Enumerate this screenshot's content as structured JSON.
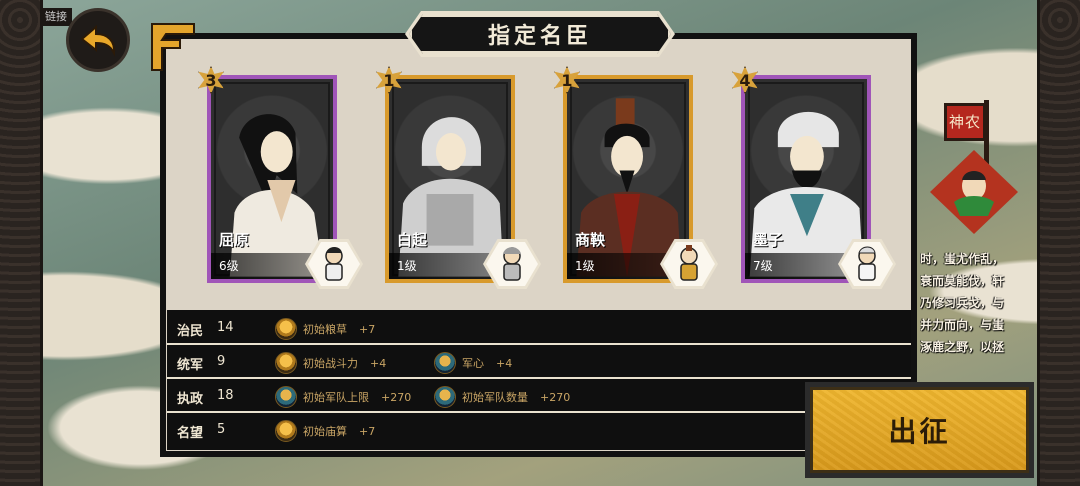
{
  "title": "指定名臣",
  "top_left_tag": "链接",
  "cards": [
    {
      "name": "屈原",
      "level": "6级",
      "rank": "3",
      "frame": "purple"
    },
    {
      "name": "白起",
      "level": "1级",
      "rank": "1",
      "frame": "gold"
    },
    {
      "name": "商鞅",
      "level": "1级",
      "rank": "1",
      "frame": "gold"
    },
    {
      "name": "墨子",
      "level": "7级",
      "rank": "4",
      "frame": "purple"
    }
  ],
  "stats": [
    {
      "key": "治民",
      "value": "14",
      "bonuses": [
        {
          "label": "初始粮草",
          "value": "+7",
          "icon": "grain-icon"
        }
      ]
    },
    {
      "key": "统军",
      "value": "9",
      "bonuses": [
        {
          "label": "初始战斗力",
          "value": "+4",
          "icon": "fist-icon"
        },
        {
          "label": "军心",
          "value": "+4",
          "icon": "morale-icon"
        }
      ]
    },
    {
      "key": "执政",
      "value": "18",
      "bonuses": [
        {
          "label": "初始军队上限",
          "value": "+270",
          "icon": "troops-icon"
        },
        {
          "label": "初始军队数量",
          "value": "+270",
          "icon": "troops-icon"
        }
      ]
    },
    {
      "key": "名望",
      "value": "5",
      "bonuses": [
        {
          "label": "初始庙算",
          "value": "+7",
          "icon": "temple-icon"
        }
      ]
    }
  ],
  "side": {
    "banner": "神农",
    "lines": [
      "时，蚩尤作乱，",
      "衰而莫能伐，轩",
      "乃修习兵戈，与",
      "并力而向，与蚩",
      "涿鹿之野，以拯"
    ]
  },
  "go_button": "出征",
  "colors": {
    "purple_frame": "#a055b8",
    "gold_frame": "#d89a2c",
    "go_button": "#e3a626"
  }
}
